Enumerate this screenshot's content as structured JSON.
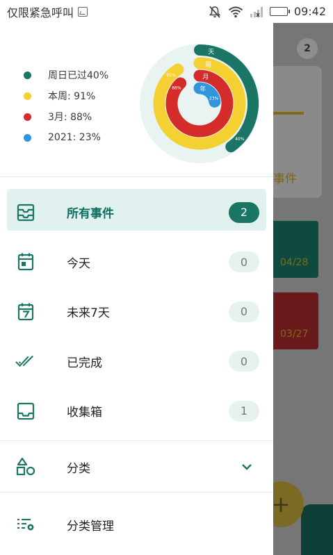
{
  "status_bar": {
    "carrier": "仅限紧急呼叫",
    "time": "09:42"
  },
  "background": {
    "badge": "2",
    "card_text": "事件",
    "event1_date": "04/28",
    "event2_date": "03/27",
    "fab": "+"
  },
  "header": {
    "legend": [
      {
        "label": "周日已过40%",
        "color": "#1a7565"
      },
      {
        "label": "本周: 91%",
        "color": "#f5d033"
      },
      {
        "label": "3月: 88%",
        "color": "#d42b2b"
      },
      {
        "label": "2021: 23%",
        "color": "#2f95dd"
      }
    ],
    "rings": {
      "ring_labels": [
        "天",
        "周",
        "月",
        "年"
      ],
      "values": [
        40,
        91,
        88,
        23
      ],
      "value_labels": [
        "40%",
        "91%",
        "88%",
        "23%"
      ],
      "colors": [
        "#1a7565",
        "#f5d033",
        "#d42b2b",
        "#2f95dd"
      ],
      "track_color": "#e9f3f2"
    }
  },
  "menu": [
    {
      "label": "所有事件",
      "count": "2",
      "icon": "all-events-icon",
      "active": true
    },
    {
      "label": "今天",
      "count": "0",
      "icon": "calendar-today-icon",
      "active": false
    },
    {
      "label": "未来7天",
      "count": "0",
      "icon": "calendar-7-icon",
      "active": false
    },
    {
      "label": "已完成",
      "count": "0",
      "icon": "double-check-icon",
      "active": false
    },
    {
      "label": "收集箱",
      "count": "1",
      "icon": "inbox-icon",
      "active": false
    }
  ],
  "category": {
    "label": "分类",
    "icon": "shapes-icon"
  },
  "category_manage": {
    "label": "分类管理",
    "icon": "list-settings-icon"
  },
  "accent_color": "#1a7565"
}
